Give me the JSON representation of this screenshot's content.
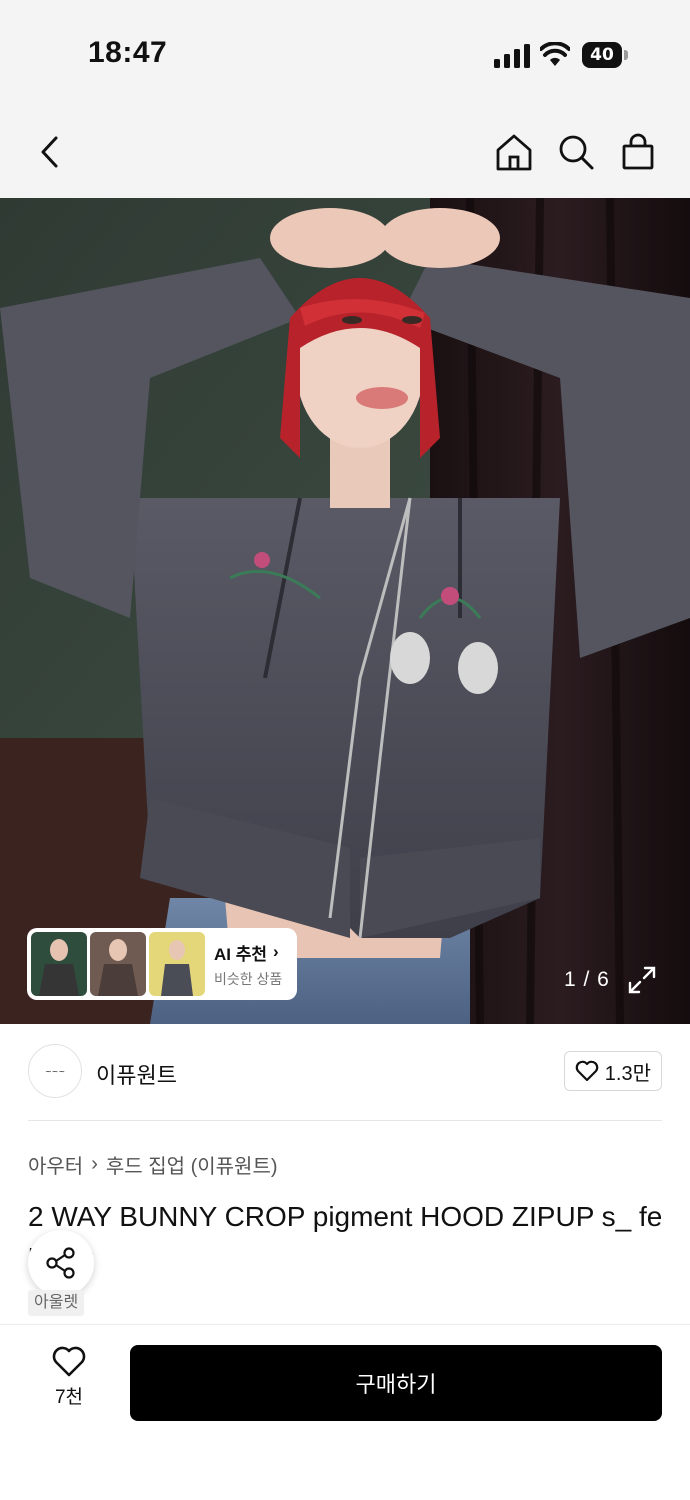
{
  "status_bar": {
    "time": "18:47",
    "battery": "40",
    "icons": [
      "signal-icon",
      "wifi-icon",
      "battery-icon"
    ]
  },
  "nav": {
    "icons": [
      "back-arrow-icon",
      "home-icon",
      "search-icon",
      "shopping-bag-icon"
    ]
  },
  "gallery": {
    "ai_title": "AI 추천",
    "ai_subtitle": "비슷한 상품",
    "counter": "1 / 6"
  },
  "brand": {
    "name": "이퓨원트",
    "likes": "1.3만"
  },
  "breadcrumb": [
    "아우터",
    "후드 집업 (이퓨원트)"
  ],
  "product": {
    "title": "2 WAY BUNNY CROP pigment HOOD ZIPUP s_ feblack",
    "badge": "아울렛"
  },
  "bottom_bar": {
    "wish_count": "7천",
    "buy_label": "구매하기"
  },
  "colors": {
    "accent": "#000000",
    "background": "#ffffff",
    "header_bg": "#f4f4f4"
  }
}
